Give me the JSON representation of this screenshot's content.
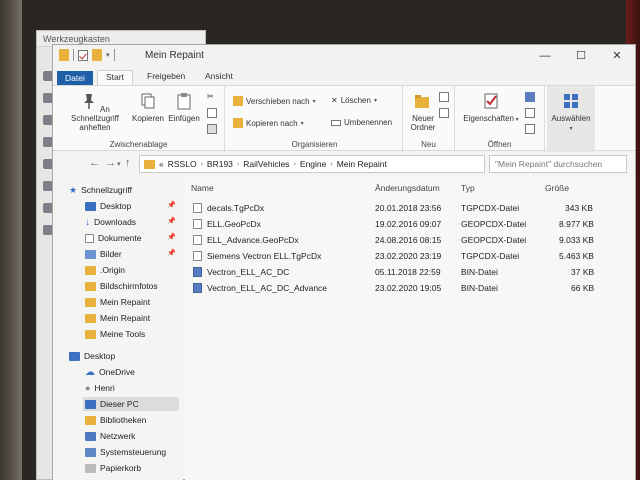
{
  "background_window": {
    "title": "Werkzeugkasten"
  },
  "window": {
    "title": "Mein Repaint",
    "controls": {
      "minimize": "—",
      "maximize": "☐",
      "close": "✕"
    }
  },
  "tabs": [
    {
      "label": "Datei"
    },
    {
      "label": "Start"
    },
    {
      "label": "Freigeben"
    },
    {
      "label": "Ansicht"
    }
  ],
  "ribbon": {
    "clipboard": {
      "label": "Zwischenablage",
      "pin": "An Schnellzugriff anheften",
      "copy": "Kopieren",
      "paste": "Einfügen"
    },
    "organize": {
      "label": "Organisieren",
      "move": "Verschieben nach",
      "copy_to": "Kopieren nach",
      "delete": "Löschen",
      "rename": "Umbenennen"
    },
    "new": {
      "label": "Neu",
      "new_folder": "Neuer Ordner"
    },
    "open": {
      "label": "Öffnen",
      "properties": "Eigenschaften"
    },
    "select": {
      "label": "Auswählen"
    }
  },
  "address": {
    "prefix": "«",
    "segments": [
      "RSSLO",
      "BR193",
      "RailVehicles",
      "Engine",
      "Mein Repaint"
    ]
  },
  "search": {
    "placeholder": "\"Mein Repaint\" durchsuchen"
  },
  "sidebar": {
    "items": [
      {
        "label": "Schnellzugriff"
      },
      {
        "label": "Desktop"
      },
      {
        "label": "Downloads"
      },
      {
        "label": "Dokumente"
      },
      {
        "label": "Bilder"
      },
      {
        "label": ".Origin"
      },
      {
        "label": "Bildschirmfotos"
      },
      {
        "label": "Mein Repaint"
      },
      {
        "label": "Mein Repaint"
      },
      {
        "label": "Meine Tools"
      },
      {
        "label": "Desktop"
      },
      {
        "label": "OneDrive"
      },
      {
        "label": "Henri"
      },
      {
        "label": "Dieser PC"
      },
      {
        "label": "Bibliotheken"
      },
      {
        "label": "Netzwerk"
      },
      {
        "label": "Systemsteuerung"
      },
      {
        "label": "Papierkorb"
      }
    ]
  },
  "columns": {
    "name": "Name",
    "date": "Änderungsdatum",
    "type": "Typ",
    "size": "Größe"
  },
  "files": [
    {
      "name": "decals.TgPcDx",
      "date": "20.01.2018 23:56",
      "type": "TGPCDX-Datei",
      "size": "343 KB"
    },
    {
      "name": "ELL.GeoPcDx",
      "date": "19.02.2016 09:07",
      "type": "GEOPCDX-Datei",
      "size": "8.977 KB"
    },
    {
      "name": "ELL_Advance.GeoPcDx",
      "date": "24.08.2016 08:15",
      "type": "GEOPCDX-Datei",
      "size": "9.033 KB"
    },
    {
      "name": "Siemens Vectron ELL.TgPcDx",
      "date": "23.02.2020 23:19",
      "type": "TGPCDX-Datei",
      "size": "5.463 KB"
    },
    {
      "name": "Vectron_ELL_AC_DC",
      "date": "05.11.2018 22:59",
      "type": "BIN-Datei",
      "size": "37 KB"
    },
    {
      "name": "Vectron_ELL_AC_DC_Advance",
      "date": "23.02.2020 19:05",
      "type": "BIN-Datei",
      "size": "66 KB"
    }
  ],
  "colors": {
    "accent": "#1f5fa8",
    "folder": "#e7b13c"
  }
}
